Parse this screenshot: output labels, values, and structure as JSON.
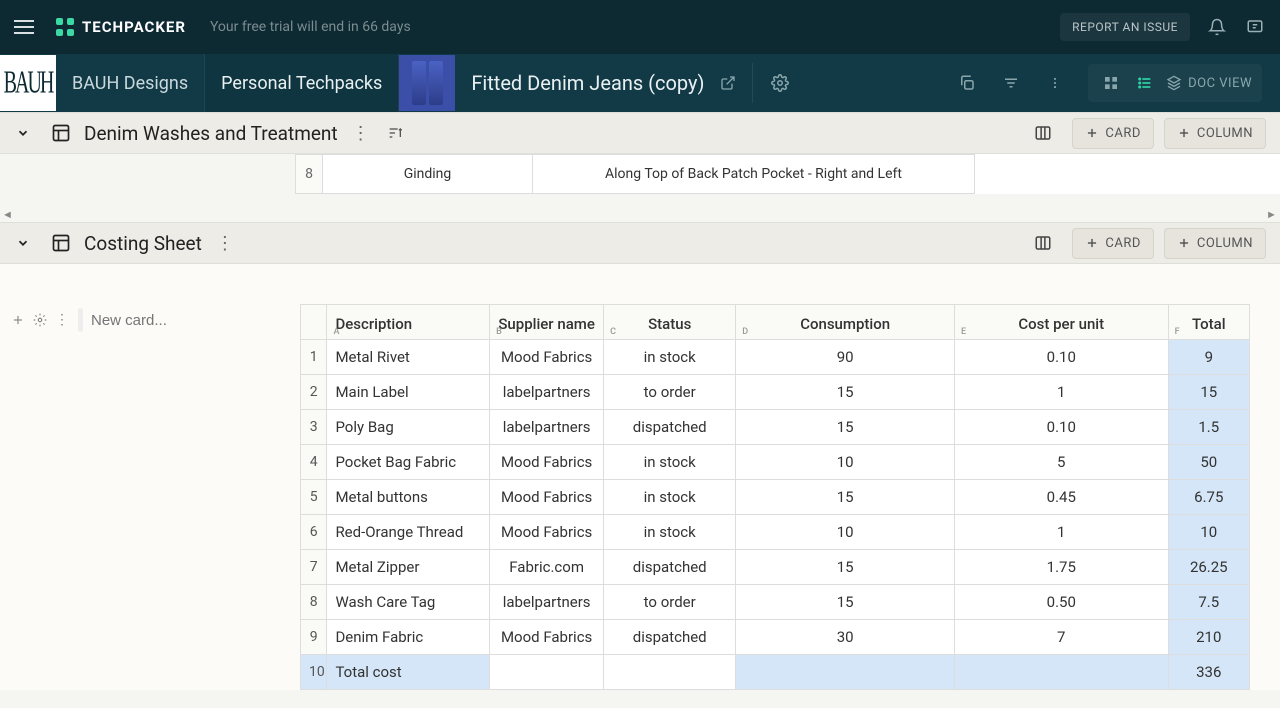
{
  "topbar": {
    "logo_text": "TECHPACKER",
    "trial_message": "Your free trial will end in 66 days",
    "report_label": "REPORT AN ISSUE"
  },
  "breadcrumb": {
    "brand_name": "BAUH",
    "item1": "BAUH Designs",
    "item2": "Personal Techpacks",
    "techpack_title": "Fitted Denim Jeans (copy)",
    "doc_view_label": "DOC VIEW"
  },
  "section1": {
    "title": "Denim Washes and Treatment",
    "card_btn": "CARD",
    "column_btn": "COLUMN",
    "row": {
      "index": "8",
      "c1": "Ginding",
      "c2": "Along Top of Back Patch Pocket - Right and Left"
    }
  },
  "section2": {
    "title": "Costing Sheet",
    "card_btn": "CARD",
    "column_btn": "COLUMN",
    "new_card_placeholder": "New card...",
    "columns": {
      "a": "Description",
      "b": "Supplier name",
      "c": "Status",
      "d": "Consumption",
      "e": "Cost per unit",
      "f": "Total"
    },
    "col_letters": {
      "a": "A",
      "b": "B",
      "c": "C",
      "d": "D",
      "e": "E",
      "f": "F"
    },
    "rows": [
      {
        "idx": "1",
        "desc": "Metal Rivet",
        "supplier": "Mood Fabrics",
        "status": "in stock",
        "cons": "90",
        "cpu": "0.10",
        "total": "9"
      },
      {
        "idx": "2",
        "desc": "Main Label",
        "supplier": "labelpartners",
        "status": "to order",
        "cons": "15",
        "cpu": "1",
        "total": "15"
      },
      {
        "idx": "3",
        "desc": "Poly Bag",
        "supplier": "labelpartners",
        "status": "dispatched",
        "cons": "15",
        "cpu": "0.10",
        "total": "1.5"
      },
      {
        "idx": "4",
        "desc": "Pocket Bag Fabric",
        "supplier": "Mood Fabrics",
        "status": "in stock",
        "cons": "10",
        "cpu": "5",
        "total": "50"
      },
      {
        "idx": "5",
        "desc": "Metal buttons",
        "supplier": "Mood Fabrics",
        "status": "in stock",
        "cons": "15",
        "cpu": "0.45",
        "total": "6.75"
      },
      {
        "idx": "6",
        "desc": "Red-Orange Thread",
        "supplier": "Mood Fabrics",
        "status": "in stock",
        "cons": "10",
        "cpu": "1",
        "total": "10"
      },
      {
        "idx": "7",
        "desc": "Metal Zipper",
        "supplier": "Fabric.com",
        "status": "dispatched",
        "cons": "15",
        "cpu": "1.75",
        "total": "26.25"
      },
      {
        "idx": "8",
        "desc": "Wash Care Tag",
        "supplier": "labelpartners",
        "status": "to order",
        "cons": "15",
        "cpu": "0.50",
        "total": "7.5"
      },
      {
        "idx": "9",
        "desc": "Denim Fabric",
        "supplier": "Mood Fabrics",
        "status": "dispatched",
        "cons": "30",
        "cpu": "7",
        "total": "210"
      }
    ],
    "total_row": {
      "idx": "10",
      "label": "Total cost",
      "total": "336"
    }
  }
}
